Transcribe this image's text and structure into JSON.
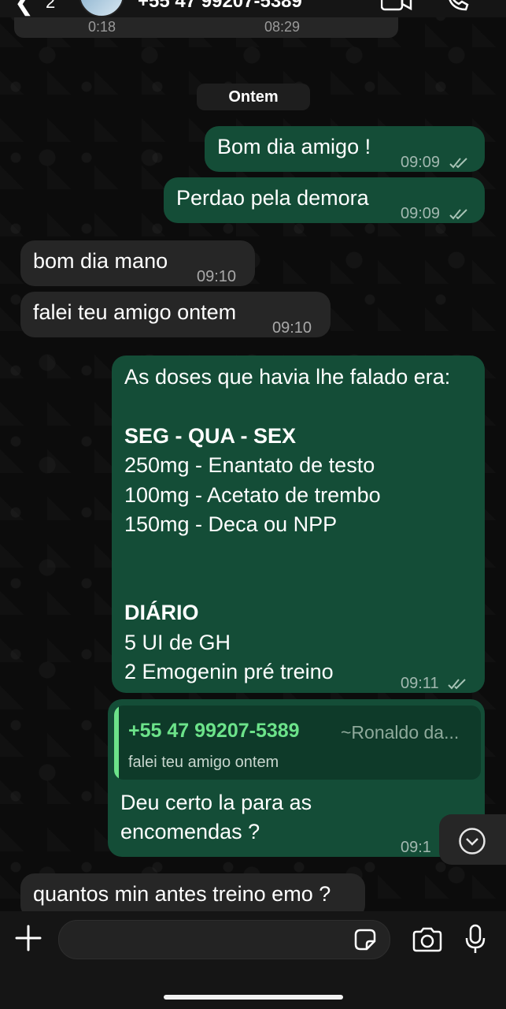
{
  "header": {
    "back_icon": "chevron-left-icon",
    "unread_count": "2",
    "contact_name": "+55 47 99207-5389",
    "video_icon": "video-call-icon",
    "phone_icon": "phone-icon"
  },
  "previous": {
    "time_left": "0:18",
    "time_right": "08:29"
  },
  "date_chip": "Ontem",
  "messages": [
    {
      "dir": "out",
      "text": "Bom dia amigo !",
      "time": "09:09",
      "status": "read"
    },
    {
      "dir": "out",
      "text": "Perdao pela demora",
      "time": "09:09",
      "status": "read"
    },
    {
      "dir": "in",
      "text": "bom dia mano",
      "time": "09:10"
    },
    {
      "dir": "in",
      "text": "falei teu amigo ontem",
      "time": "09:10"
    },
    {
      "dir": "out",
      "lines": [
        "As doses que havia lhe falado era:",
        "",
        "SEG - QUA - SEX",
        "250mg - Enantato de testo",
        "100mg - Acetato de trembo",
        "150mg - Deca ou NPP",
        "",
        "",
        "DIÁRIO",
        "5 UI de GH",
        "2 Emogenin pré treino"
      ],
      "time": "09:11",
      "status": "read"
    },
    {
      "dir": "out",
      "reply_to": {
        "name": "+55 47 99207-5389",
        "alias": "~Ronaldo da...",
        "text": "falei teu amigo ontem"
      },
      "lines": [
        "Deu certo la para as",
        "encomendas ?"
      ],
      "time": "09:1"
    },
    {
      "dir": "in",
      "text": "quantos min antes treino emo ?"
    }
  ],
  "scroll_down_icon": "chevron-down-circle-icon",
  "composer": {
    "add_icon": "plus-icon",
    "input_placeholder": "",
    "sticker_icon": "sticker-icon",
    "camera_icon": "camera-icon",
    "mic_icon": "microphone-icon"
  },
  "colors": {
    "outgoing_bubble": "#144d37",
    "incoming_bubble": "#262626",
    "quote_accent": "#6ce38a",
    "background": "#0b0b0b"
  }
}
